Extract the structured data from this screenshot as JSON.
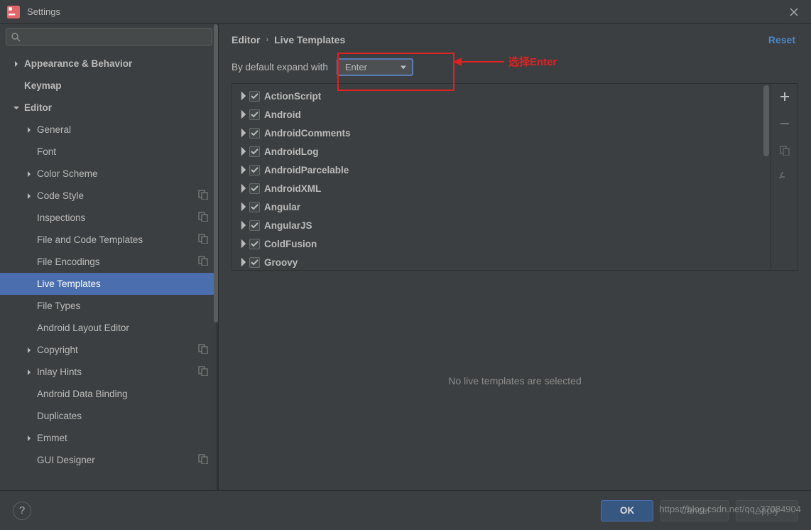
{
  "window": {
    "title": "Settings"
  },
  "breadcrumb": {
    "root": "Editor",
    "leaf": "Live Templates"
  },
  "reset_label": "Reset",
  "expand": {
    "label": "By default expand with",
    "value": "Enter"
  },
  "annotation": {
    "text": "选择Enter"
  },
  "sidebar": {
    "items": [
      {
        "label": "Appearance & Behavior",
        "level": 0,
        "arrow": "right",
        "bold": true
      },
      {
        "label": "Keymap",
        "level": 0,
        "arrow": "none",
        "bold": true
      },
      {
        "label": "Editor",
        "level": 0,
        "arrow": "down",
        "bold": true
      },
      {
        "label": "General",
        "level": 1,
        "arrow": "right"
      },
      {
        "label": "Font",
        "level": 1,
        "arrow": "none"
      },
      {
        "label": "Color Scheme",
        "level": 1,
        "arrow": "right"
      },
      {
        "label": "Code Style",
        "level": 1,
        "arrow": "right",
        "copy": true
      },
      {
        "label": "Inspections",
        "level": 1,
        "arrow": "none",
        "copy": true
      },
      {
        "label": "File and Code Templates",
        "level": 1,
        "arrow": "none",
        "copy": true
      },
      {
        "label": "File Encodings",
        "level": 1,
        "arrow": "none",
        "copy": true
      },
      {
        "label": "Live Templates",
        "level": 1,
        "arrow": "none",
        "selected": true
      },
      {
        "label": "File Types",
        "level": 1,
        "arrow": "none"
      },
      {
        "label": "Android Layout Editor",
        "level": 1,
        "arrow": "none"
      },
      {
        "label": "Copyright",
        "level": 1,
        "arrow": "right",
        "copy": true
      },
      {
        "label": "Inlay Hints",
        "level": 1,
        "arrow": "right",
        "copy": true
      },
      {
        "label": "Android Data Binding",
        "level": 1,
        "arrow": "none"
      },
      {
        "label": "Duplicates",
        "level": 1,
        "arrow": "none"
      },
      {
        "label": "Emmet",
        "level": 1,
        "arrow": "right"
      },
      {
        "label": "GUI Designer",
        "level": 1,
        "arrow": "none",
        "copy": true
      }
    ]
  },
  "templates": [
    {
      "label": "ActionScript"
    },
    {
      "label": "Android"
    },
    {
      "label": "AndroidComments"
    },
    {
      "label": "AndroidLog"
    },
    {
      "label": "AndroidParcelable"
    },
    {
      "label": "AndroidXML"
    },
    {
      "label": "Angular"
    },
    {
      "label": "AngularJS"
    },
    {
      "label": "ColdFusion"
    },
    {
      "label": "Groovy"
    }
  ],
  "preview": {
    "empty_text": "No live templates are selected"
  },
  "buttons": {
    "ok": "OK",
    "cancel": "Cancel",
    "apply": "Apply"
  },
  "watermark": "https://blog.csdn.net/qq_37084904"
}
